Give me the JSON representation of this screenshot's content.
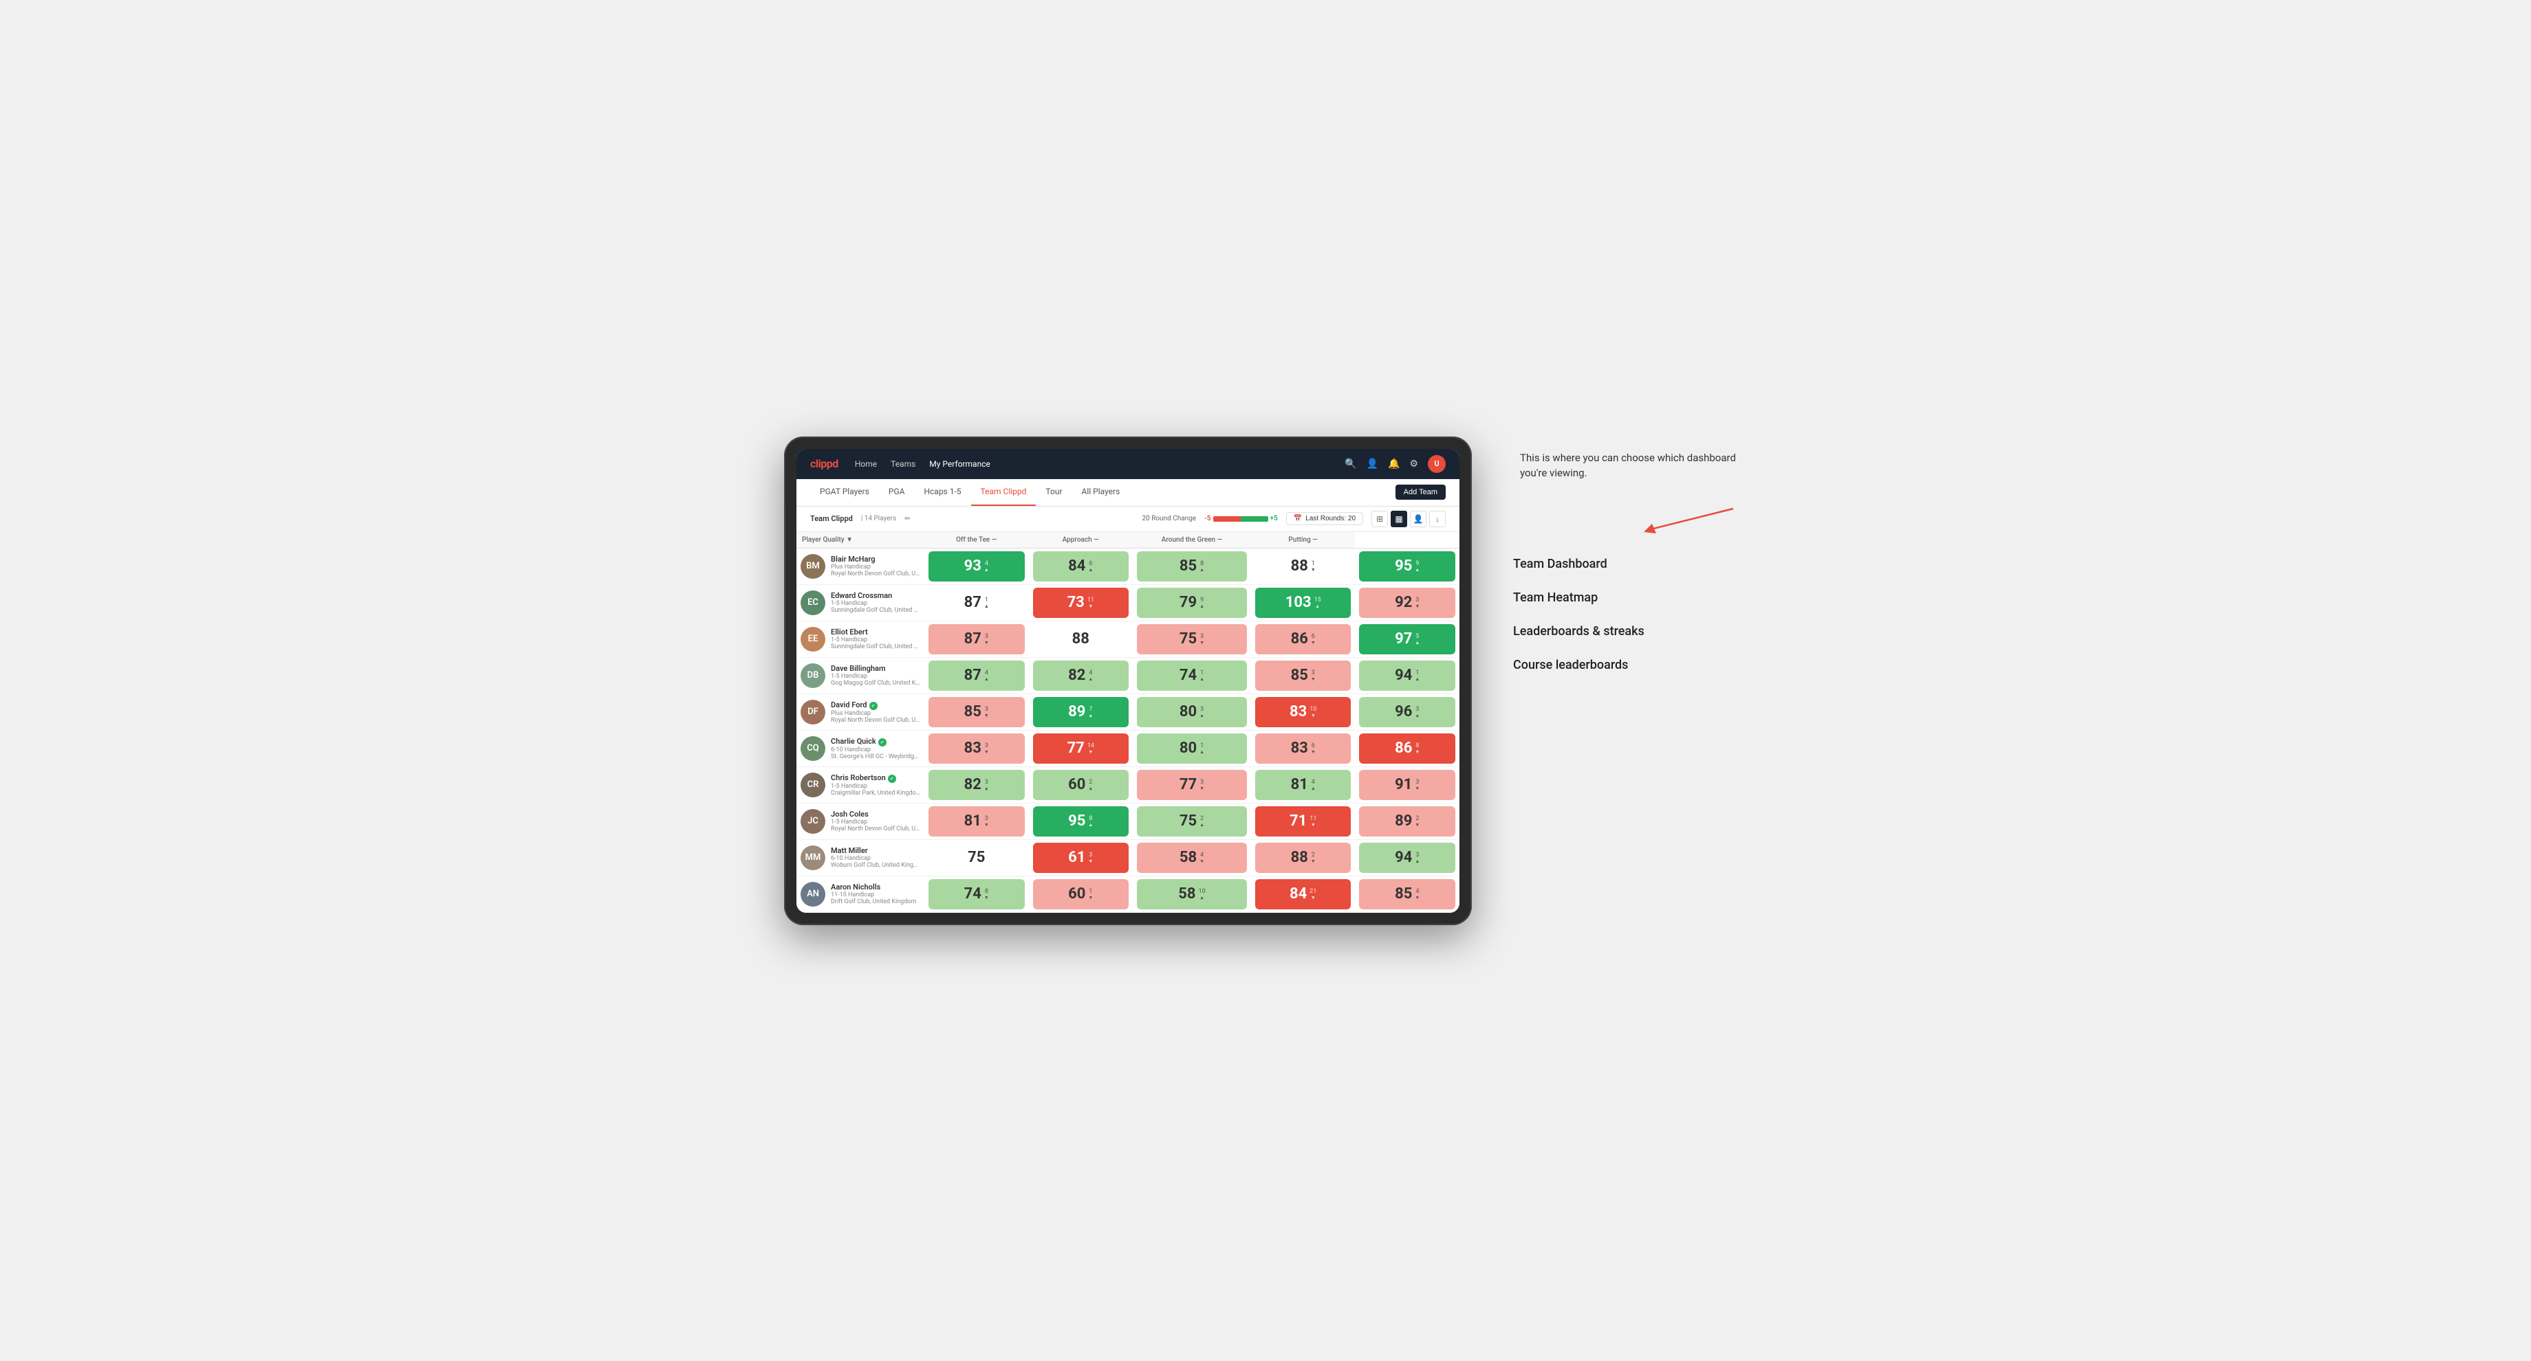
{
  "app": {
    "logo": "clippd",
    "nav": {
      "links": [
        "Home",
        "Teams",
        "My Performance"
      ]
    },
    "sub_nav": {
      "links": [
        "PGAT Players",
        "PGA",
        "Hcaps 1-5",
        "Team Clippd",
        "Tour",
        "All Players"
      ],
      "active": "Team Clippd"
    },
    "add_team_label": "Add Team"
  },
  "team_header": {
    "name": "Team Clippd",
    "player_count": "14 Players",
    "round_change_label": "20 Round Change",
    "neg_label": "-5",
    "pos_label": "+5",
    "last_rounds_label": "Last Rounds:",
    "last_rounds_value": "20"
  },
  "table": {
    "columns": {
      "player": "Player Quality ▼",
      "off_tee": "Off the Tee —",
      "approach": "Approach —",
      "around_green": "Around the Green —",
      "putting": "Putting —"
    },
    "players": [
      {
        "name": "Blair McHarg",
        "handicap": "Plus Handicap",
        "club": "Royal North Devon Golf Club, United Kingdom",
        "avatar_color": "#8B7355",
        "initials": "BM",
        "scores": {
          "quality": {
            "value": 93,
            "change": 4,
            "dir": "up",
            "color": "bg-green-strong"
          },
          "off_tee": {
            "value": 84,
            "change": 6,
            "dir": "up",
            "color": "bg-green-light"
          },
          "approach": {
            "value": 85,
            "change": 8,
            "dir": "up",
            "color": "bg-green-light"
          },
          "around_green": {
            "value": 88,
            "change": 1,
            "dir": "down",
            "color": "bg-white"
          },
          "putting": {
            "value": 95,
            "change": 9,
            "dir": "up",
            "color": "bg-green-strong"
          }
        }
      },
      {
        "name": "Edward Crossman",
        "handicap": "1-5 Handicap",
        "club": "Sunningdale Golf Club, United Kingdom",
        "avatar_color": "#5B8A6B",
        "initials": "EC",
        "scores": {
          "quality": {
            "value": 87,
            "change": 1,
            "dir": "up",
            "color": "bg-white"
          },
          "off_tee": {
            "value": 73,
            "change": 11,
            "dir": "down",
            "color": "bg-red-strong"
          },
          "approach": {
            "value": 79,
            "change": 9,
            "dir": "up",
            "color": "bg-green-light"
          },
          "around_green": {
            "value": 103,
            "change": 15,
            "dir": "up",
            "color": "bg-green-strong"
          },
          "putting": {
            "value": 92,
            "change": 3,
            "dir": "down",
            "color": "bg-red-light"
          }
        }
      },
      {
        "name": "Elliot Ebert",
        "handicap": "1-5 Handicap",
        "club": "Sunningdale Golf Club, United Kingdom",
        "avatar_color": "#C0845A",
        "initials": "EE",
        "scores": {
          "quality": {
            "value": 87,
            "change": 3,
            "dir": "down",
            "color": "bg-red-light"
          },
          "off_tee": {
            "value": 88,
            "change": 0,
            "dir": "",
            "color": "bg-white"
          },
          "approach": {
            "value": 75,
            "change": 3,
            "dir": "down",
            "color": "bg-red-light"
          },
          "around_green": {
            "value": 86,
            "change": 6,
            "dir": "down",
            "color": "bg-red-light"
          },
          "putting": {
            "value": 97,
            "change": 5,
            "dir": "up",
            "color": "bg-green-strong"
          }
        }
      },
      {
        "name": "Dave Billingham",
        "handicap": "1-5 Handicap",
        "club": "Gog Magog Golf Club, United Kingdom",
        "avatar_color": "#7B9E87",
        "initials": "DB",
        "scores": {
          "quality": {
            "value": 87,
            "change": 4,
            "dir": "up",
            "color": "bg-green-light"
          },
          "off_tee": {
            "value": 82,
            "change": 4,
            "dir": "up",
            "color": "bg-green-light"
          },
          "approach": {
            "value": 74,
            "change": 1,
            "dir": "up",
            "color": "bg-green-light"
          },
          "around_green": {
            "value": 85,
            "change": 3,
            "dir": "down",
            "color": "bg-red-light"
          },
          "putting": {
            "value": 94,
            "change": 1,
            "dir": "up",
            "color": "bg-green-light"
          }
        }
      },
      {
        "name": "David Ford",
        "handicap": "Plus Handicap",
        "club": "Royal North Devon Golf Club, United Kingdom",
        "avatar_color": "#A0725A",
        "initials": "DF",
        "verified": true,
        "scores": {
          "quality": {
            "value": 85,
            "change": 3,
            "dir": "down",
            "color": "bg-red-light"
          },
          "off_tee": {
            "value": 89,
            "change": 7,
            "dir": "up",
            "color": "bg-green-strong"
          },
          "approach": {
            "value": 80,
            "change": 3,
            "dir": "up",
            "color": "bg-green-light"
          },
          "around_green": {
            "value": 83,
            "change": 10,
            "dir": "down",
            "color": "bg-red-strong"
          },
          "putting": {
            "value": 96,
            "change": 3,
            "dir": "up",
            "color": "bg-green-light"
          }
        }
      },
      {
        "name": "Charlie Quick",
        "handicap": "6-10 Handicap",
        "club": "St. George's Hill GC - Weybridge - Surrey, Uni...",
        "avatar_color": "#6B8E6B",
        "initials": "CQ",
        "verified": true,
        "scores": {
          "quality": {
            "value": 83,
            "change": 3,
            "dir": "down",
            "color": "bg-red-light"
          },
          "off_tee": {
            "value": 77,
            "change": 14,
            "dir": "down",
            "color": "bg-red-strong"
          },
          "approach": {
            "value": 80,
            "change": 1,
            "dir": "up",
            "color": "bg-green-light"
          },
          "around_green": {
            "value": 83,
            "change": 6,
            "dir": "down",
            "color": "bg-red-light"
          },
          "putting": {
            "value": 86,
            "change": 8,
            "dir": "down",
            "color": "bg-red-strong"
          }
        }
      },
      {
        "name": "Chris Robertson",
        "handicap": "1-5 Handicap",
        "club": "Craigmillar Park, United Kingdom",
        "avatar_color": "#7A6B5A",
        "initials": "CR",
        "verified": true,
        "scores": {
          "quality": {
            "value": 82,
            "change": 3,
            "dir": "up",
            "color": "bg-green-light"
          },
          "off_tee": {
            "value": 60,
            "change": 2,
            "dir": "up",
            "color": "bg-green-light"
          },
          "approach": {
            "value": 77,
            "change": 3,
            "dir": "down",
            "color": "bg-red-light"
          },
          "around_green": {
            "value": 81,
            "change": 4,
            "dir": "up",
            "color": "bg-green-light"
          },
          "putting": {
            "value": 91,
            "change": 3,
            "dir": "down",
            "color": "bg-red-light"
          }
        }
      },
      {
        "name": "Josh Coles",
        "handicap": "1-5 Handicap",
        "club": "Royal North Devon Golf Club, United Kingdom",
        "avatar_color": "#8A7060",
        "initials": "JC",
        "scores": {
          "quality": {
            "value": 81,
            "change": 3,
            "dir": "down",
            "color": "bg-red-light"
          },
          "off_tee": {
            "value": 95,
            "change": 8,
            "dir": "up",
            "color": "bg-green-strong"
          },
          "approach": {
            "value": 75,
            "change": 2,
            "dir": "up",
            "color": "bg-green-light"
          },
          "around_green": {
            "value": 71,
            "change": 11,
            "dir": "down",
            "color": "bg-red-strong"
          },
          "putting": {
            "value": 89,
            "change": 2,
            "dir": "down",
            "color": "bg-red-light"
          }
        }
      },
      {
        "name": "Matt Miller",
        "handicap": "6-10 Handicap",
        "club": "Woburn Golf Club, United Kingdom",
        "avatar_color": "#9B8B7B",
        "initials": "MM",
        "scores": {
          "quality": {
            "value": 75,
            "change": 0,
            "dir": "",
            "color": "bg-white"
          },
          "off_tee": {
            "value": 61,
            "change": 3,
            "dir": "down",
            "color": "bg-red-strong"
          },
          "approach": {
            "value": 58,
            "change": 4,
            "dir": "down",
            "color": "bg-red-light"
          },
          "around_green": {
            "value": 88,
            "change": 2,
            "dir": "down",
            "color": "bg-red-light"
          },
          "putting": {
            "value": 94,
            "change": 3,
            "dir": "up",
            "color": "bg-green-light"
          }
        }
      },
      {
        "name": "Aaron Nicholls",
        "handicap": "11-15 Handicap",
        "club": "Drift Golf Club, United Kingdom",
        "avatar_color": "#6A7A8A",
        "initials": "AN",
        "scores": {
          "quality": {
            "value": 74,
            "change": 8,
            "dir": "down",
            "color": "bg-green-light"
          },
          "off_tee": {
            "value": 60,
            "change": 1,
            "dir": "down",
            "color": "bg-red-light"
          },
          "approach": {
            "value": 58,
            "change": 10,
            "dir": "up",
            "color": "bg-green-light"
          },
          "around_green": {
            "value": 84,
            "change": 21,
            "dir": "down",
            "color": "bg-red-strong"
          },
          "putting": {
            "value": 85,
            "change": 4,
            "dir": "down",
            "color": "bg-red-light"
          }
        }
      }
    ]
  },
  "annotation": {
    "text": "This is where you can choose which dashboard you're viewing.",
    "dashboard_items": [
      "Team Dashboard",
      "Team Heatmap",
      "Leaderboards & streaks",
      "Course leaderboards"
    ]
  }
}
